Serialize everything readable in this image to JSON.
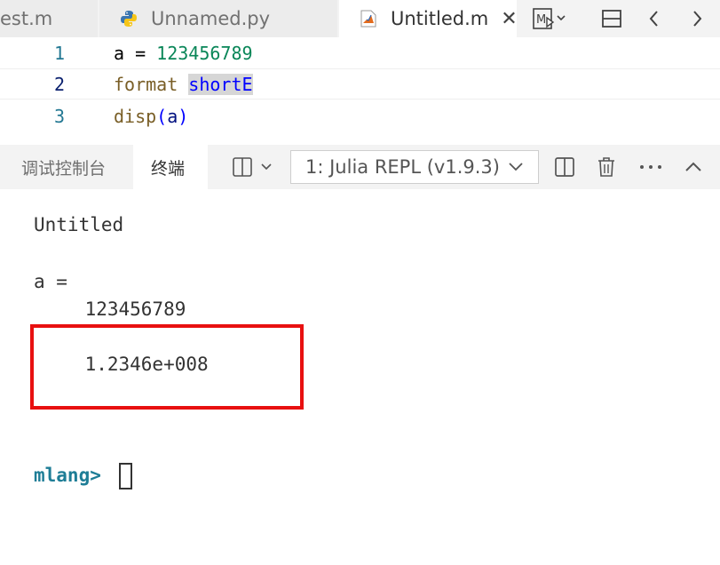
{
  "tabs": [
    {
      "label": "est.m"
    },
    {
      "label": "Unnamed.py"
    },
    {
      "label": "Untitled.m"
    }
  ],
  "tab_close": "✕",
  "editor": {
    "lines": [
      {
        "num": "1",
        "var": "a",
        "op": " = ",
        "value": "123456789"
      },
      {
        "num": "2",
        "cmd": "format",
        "arg": "shortE"
      },
      {
        "num": "3",
        "fn": "disp",
        "paren_open": "(",
        "arg": "a",
        "paren_close": ")"
      }
    ]
  },
  "panel": {
    "tabs": [
      {
        "label": "调试控制台"
      },
      {
        "label": "终端"
      }
    ],
    "terminal_select": "1: Julia REPL (v1.9.3)"
  },
  "terminal": {
    "lines": [
      "Untitled",
      "a =",
      "    123456789",
      "    1.2346e+008"
    ],
    "prompt": "mlang>"
  },
  "colors": {
    "highlight_box": "#e81010",
    "prompt": "#1e7d96",
    "number": "#098658"
  }
}
